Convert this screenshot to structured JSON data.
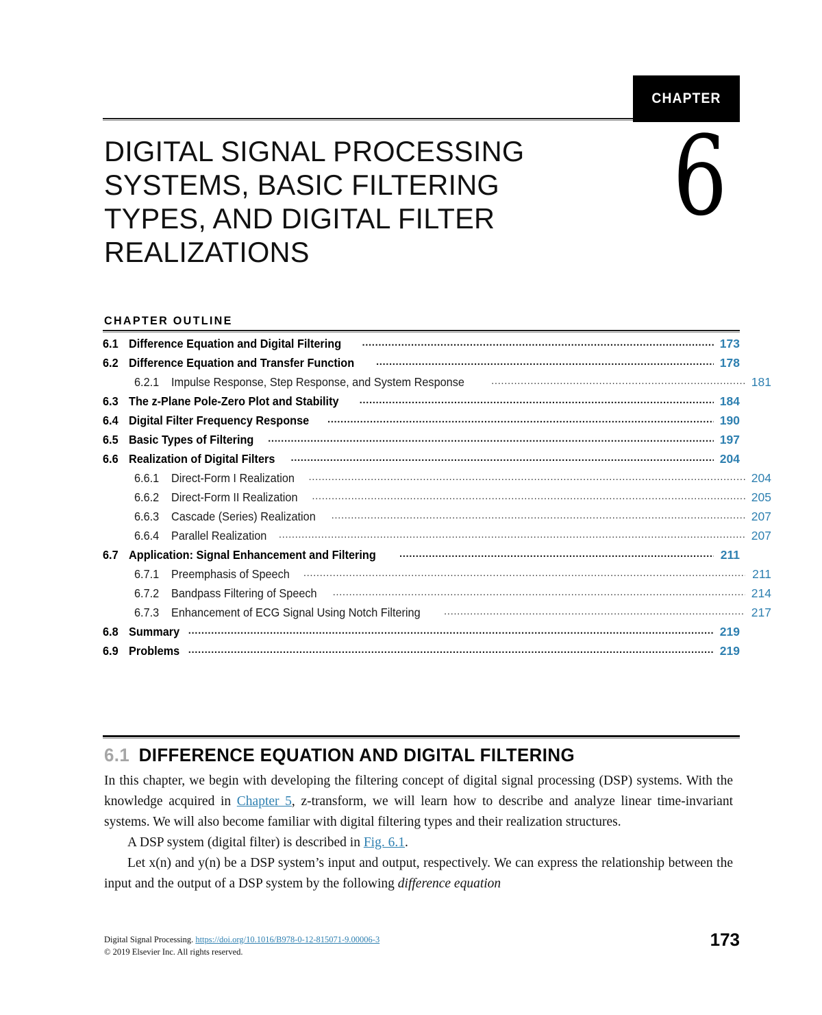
{
  "header": {
    "chapter_tab_label": "CHAPTER",
    "chapter_number": "6",
    "chapter_title": "DIGITAL SIGNAL PROCESSING SYSTEMS, BASIC FILTERING TYPES, AND DIGITAL FILTER REALIZATIONS"
  },
  "outline": {
    "heading": "CHAPTER OUTLINE",
    "entries": [
      {
        "level": 1,
        "num": "6.1",
        "label": "Difference Equation and Digital Filtering",
        "page": "173"
      },
      {
        "level": 1,
        "num": "6.2",
        "label": "Difference Equation and Transfer Function",
        "page": "178"
      },
      {
        "level": 2,
        "num": "6.2.1",
        "label": "Impulse Response, Step Response, and System Response",
        "page": "181"
      },
      {
        "level": 1,
        "num": "6.3",
        "label": "The z-Plane Pole-Zero Plot and Stability",
        "page": "184"
      },
      {
        "level": 1,
        "num": "6.4",
        "label": "Digital Filter Frequency Response",
        "page": "190"
      },
      {
        "level": 1,
        "num": "6.5",
        "label": "Basic Types of Filtering",
        "page": "197"
      },
      {
        "level": 1,
        "num": "6.6",
        "label": "Realization of Digital Filters",
        "page": "204"
      },
      {
        "level": 2,
        "num": "6.6.1",
        "label": "Direct-Form I Realization",
        "page": "204"
      },
      {
        "level": 2,
        "num": "6.6.2",
        "label": "Direct-Form II Realization",
        "page": "205"
      },
      {
        "level": 2,
        "num": "6.6.3",
        "label": "Cascade (Series) Realization",
        "page": "207"
      },
      {
        "level": 2,
        "num": "6.6.4",
        "label": "Parallel Realization",
        "page": "207"
      },
      {
        "level": 1,
        "num": "6.7",
        "label": "Application: Signal Enhancement and Filtering",
        "page": "211"
      },
      {
        "level": 2,
        "num": "6.7.1",
        "label": "Preemphasis of Speech",
        "page": "211"
      },
      {
        "level": 2,
        "num": "6.7.2",
        "label": "Bandpass Filtering of Speech",
        "page": "214"
      },
      {
        "level": 2,
        "num": "6.7.3",
        "label": "Enhancement of ECG Signal Using Notch Filtering",
        "page": "217"
      },
      {
        "level": 1,
        "num": "6.8",
        "label": "Summary",
        "page": "219"
      },
      {
        "level": 1,
        "num": "6.9",
        "label": "Problems",
        "page": "219"
      }
    ]
  },
  "section": {
    "number": "6.1",
    "title": "DIFFERENCE EQUATION AND DIGITAL FILTERING",
    "paragraphs": {
      "p1_a": "In this chapter, we begin with developing the filtering concept of digital signal processing (DSP) systems. With the knowledge acquired in ",
      "p1_link": "Chapter 5",
      "p1_b": ", z-transform, we will learn how to describe and analyze linear time-invariant systems. We will also become familiar with digital filtering types and their realization structures.",
      "p2_a": "A DSP system (digital filter) is described in ",
      "p2_link": "Fig. 6.1",
      "p2_b": ".",
      "p3_a": "Let x(n) and y(n) be a DSP system’s input and output, respectively. We can express the relationship between the input and the output of a DSP system by the following ",
      "p3_italic": "difference equation"
    }
  },
  "footer": {
    "source_title": "Digital Signal Processing.",
    "doi": "https://doi.org/10.1016/B978-0-12-815071-9.00006-3",
    "copyright": "© 2019 Elsevier Inc. All rights reserved.",
    "page_number": "173"
  },
  "colors": {
    "link_blue": "#2d7fb0",
    "section_number_gray": "#a6a6a6",
    "tab_black": "#000000"
  }
}
